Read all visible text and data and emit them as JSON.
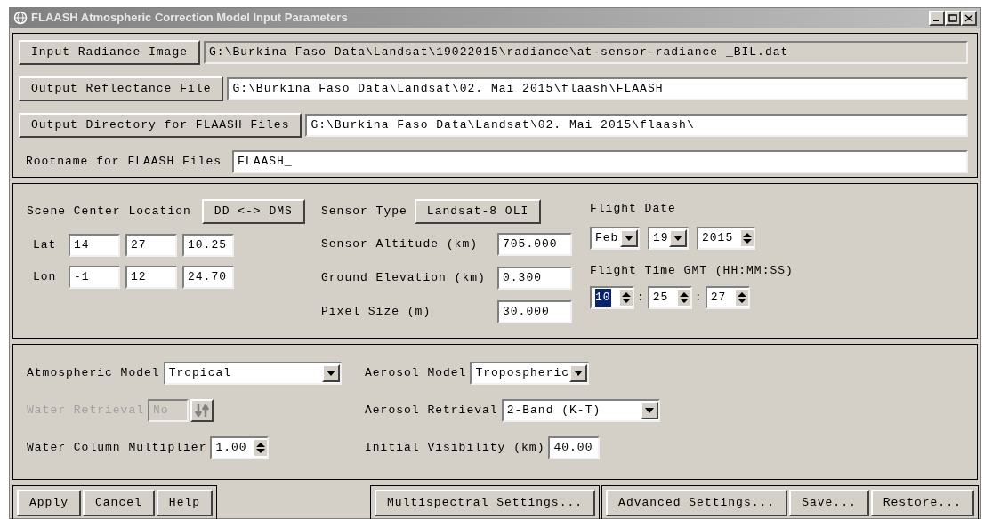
{
  "window": {
    "title": "FLAASH Atmospheric Correction Model Input Parameters"
  },
  "files": [
    {
      "kind": "button",
      "label": "Input Radiance Image",
      "value": "G:\\Burkina Faso Data\\Landsat\\19022015\\radiance\\at-sensor-radiance _BIL.dat",
      "disabled": true
    },
    {
      "kind": "button",
      "label": "Output Reflectance File",
      "value": "G:\\Burkina Faso Data\\Landsat\\02. Mai 2015\\flaash\\FLAASH",
      "disabled": false
    },
    {
      "kind": "button",
      "label": "Output Directory for FLAASH Files",
      "value": "G:\\Burkina Faso Data\\Landsat\\02. Mai 2015\\flaash\\",
      "disabled": false
    },
    {
      "kind": "label",
      "label": "Rootname for FLAASH Files",
      "value": "FLAASH_",
      "disabled": false
    }
  ],
  "scene": {
    "label": "Scene Center Location",
    "convert_button": "DD <-> DMS",
    "rows": [
      {
        "label": "Lat",
        "values": [
          "14",
          "27",
          "10.25"
        ]
      },
      {
        "label": "Lon",
        "values": [
          "-1",
          "12",
          "24.70"
        ]
      }
    ]
  },
  "sensor": {
    "type_label": "Sensor Type",
    "type_button": "Landsat-8 OLI",
    "fields": [
      {
        "label": "Sensor Altitude (km)",
        "value": "705.000"
      },
      {
        "label": "Ground Elevation (km)",
        "value": "0.300"
      },
      {
        "label": "Pixel Size (m)",
        "value": "30.000"
      }
    ]
  },
  "flight_date": {
    "label": "Flight Date",
    "month": "Feb",
    "day": "19",
    "year": "2015"
  },
  "flight_time": {
    "label": "Flight Time GMT (HH:MM:SS)",
    "separator": ":",
    "parts": [
      {
        "value": "10",
        "selected": true
      },
      {
        "value": "25",
        "selected": false
      },
      {
        "value": "27",
        "selected": false
      }
    ]
  },
  "atmosphere": {
    "left": [
      {
        "kind": "dropdown",
        "label": "Atmospheric Model",
        "value": "Tropical",
        "disabled": false
      },
      {
        "kind": "toggle",
        "label": "Water Retrieval",
        "value": "No",
        "disabled": true
      },
      {
        "kind": "spinner",
        "label": "Water Column Multiplier",
        "value": "1.00",
        "disabled": false
      }
    ],
    "right": [
      {
        "kind": "dropdown",
        "label": "Aerosol Model",
        "value": "Tropospheric",
        "disabled": false
      },
      {
        "kind": "dropdown",
        "label": "Aerosol Retrieval",
        "value": "2-Band (K-T)",
        "disabled": false
      },
      {
        "kind": "field",
        "label": "Initial Visibility (km)",
        "value": "40.00",
        "disabled": false
      }
    ]
  },
  "button_groups": [
    [
      "Apply",
      "Cancel",
      "Help"
    ],
    [
      "Multispectral Settings..."
    ],
    [
      "Advanced Settings...",
      "Save...",
      "Restore..."
    ]
  ]
}
